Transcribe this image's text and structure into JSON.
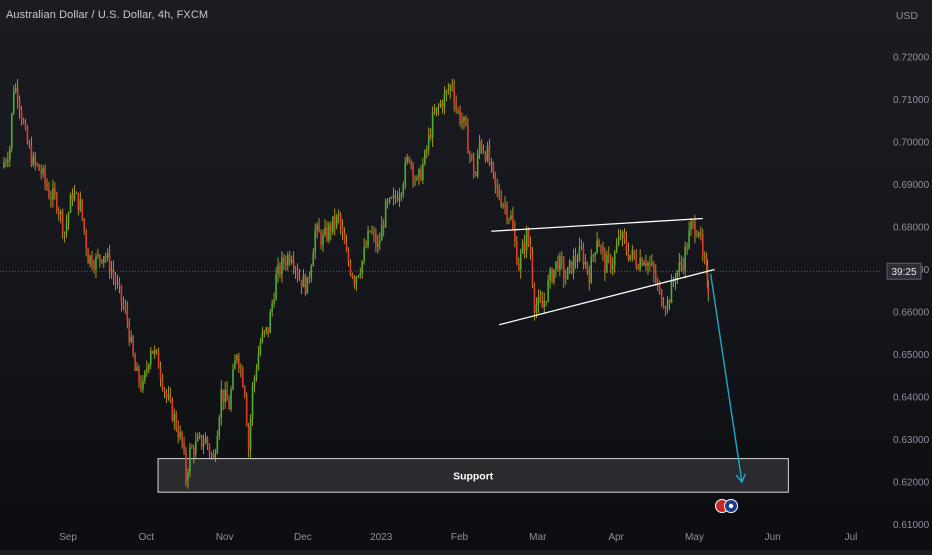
{
  "header": {
    "title": "Australian Dollar / U.S. Dollar, 4h, FXCM",
    "currency": "USD"
  },
  "price_badge": "39:25",
  "colors": {
    "up": "#4caf2f",
    "down": "#e23b2e",
    "wick": "#c8b21e",
    "pattern": "#ffffff",
    "arrow": "#1fa7c9",
    "support_fill": "#2f3034",
    "support_border": "#d8d8d8"
  },
  "chart_data": {
    "type": "line",
    "title": "Australian Dollar / U.S. Dollar, 4h, FXCM",
    "xlabel": "",
    "ylabel": "USD",
    "ylim": [
      0.606,
      0.726
    ],
    "y_ticks": [
      "0.72000",
      "0.71000",
      "0.70000",
      "0.69000",
      "0.68000",
      "0.67000",
      "0.66000",
      "0.65000",
      "0.64000",
      "0.63000",
      "0.62000",
      "0.61000"
    ],
    "x_ticks": [
      "Sep",
      "Oct",
      "Nov",
      "Dec",
      "2023",
      "Feb",
      "Mar",
      "Apr",
      "May",
      "Jun",
      "Jul"
    ],
    "x_positions": [
      1,
      2,
      3,
      4,
      5,
      6,
      7,
      8,
      9,
      10,
      11
    ],
    "series": [
      {
        "values": [
          [
            0.0,
            0.694
          ],
          [
            0.1,
            0.699
          ],
          [
            0.15,
            0.713
          ],
          [
            0.2,
            0.712
          ],
          [
            0.3,
            0.701
          ],
          [
            0.4,
            0.695
          ],
          [
            0.5,
            0.693
          ],
          [
            0.6,
            0.688
          ],
          [
            0.7,
            0.686
          ],
          [
            0.8,
            0.679
          ],
          [
            0.9,
            0.688
          ],
          [
            1.0,
            0.685
          ],
          [
            1.1,
            0.673
          ],
          [
            1.2,
            0.672
          ],
          [
            1.3,
            0.674
          ],
          [
            1.4,
            0.67
          ],
          [
            1.5,
            0.664
          ],
          [
            1.6,
            0.658
          ],
          [
            1.7,
            0.646
          ],
          [
            1.8,
            0.642
          ],
          [
            1.9,
            0.652
          ],
          [
            2.0,
            0.648
          ],
          [
            2.1,
            0.64
          ],
          [
            2.2,
            0.635
          ],
          [
            2.3,
            0.629
          ],
          [
            2.35,
            0.621
          ],
          [
            2.4,
            0.627
          ],
          [
            2.5,
            0.629
          ],
          [
            2.6,
            0.63
          ],
          [
            2.7,
            0.625
          ],
          [
            2.8,
            0.641
          ],
          [
            2.9,
            0.638
          ],
          [
            3.0,
            0.651
          ],
          [
            3.1,
            0.642
          ],
          [
            3.15,
            0.628
          ],
          [
            3.2,
            0.642
          ],
          [
            3.3,
            0.653
          ],
          [
            3.4,
            0.656
          ],
          [
            3.5,
            0.668
          ],
          [
            3.6,
            0.672
          ],
          [
            3.7,
            0.674
          ],
          [
            3.8,
            0.668
          ],
          [
            3.9,
            0.666
          ],
          [
            4.0,
            0.679
          ],
          [
            4.1,
            0.677
          ],
          [
            4.2,
            0.68
          ],
          [
            4.3,
            0.682
          ],
          [
            4.4,
            0.673
          ],
          [
            4.5,
            0.668
          ],
          [
            4.6,
            0.672
          ],
          [
            4.7,
            0.679
          ],
          [
            4.8,
            0.675
          ],
          [
            4.9,
            0.684
          ],
          [
            5.0,
            0.686
          ],
          [
            5.1,
            0.69
          ],
          [
            5.2,
            0.697
          ],
          [
            5.3,
            0.69
          ],
          [
            5.4,
            0.696
          ],
          [
            5.5,
            0.705
          ],
          [
            5.6,
            0.709
          ],
          [
            5.7,
            0.712
          ],
          [
            5.75,
            0.714
          ],
          [
            5.8,
            0.708
          ],
          [
            5.9,
            0.704
          ],
          [
            6.0,
            0.695
          ],
          [
            6.05,
            0.692
          ],
          [
            6.1,
            0.7
          ],
          [
            6.2,
            0.697
          ],
          [
            6.3,
            0.689
          ],
          [
            6.4,
            0.686
          ],
          [
            6.5,
            0.682
          ],
          [
            6.55,
            0.676
          ],
          [
            6.6,
            0.671
          ],
          [
            6.7,
            0.678
          ],
          [
            6.75,
            0.674
          ],
          [
            6.8,
            0.662
          ],
          [
            6.9,
            0.661
          ],
          [
            7.0,
            0.668
          ],
          [
            7.1,
            0.672
          ],
          [
            7.2,
            0.668
          ],
          [
            7.3,
            0.672
          ],
          [
            7.4,
            0.674
          ],
          [
            7.5,
            0.669
          ],
          [
            7.6,
            0.678
          ],
          [
            7.7,
            0.671
          ],
          [
            7.8,
            0.672
          ],
          [
            7.9,
            0.678
          ],
          [
            8.0,
            0.674
          ],
          [
            8.1,
            0.672
          ],
          [
            8.2,
            0.673
          ],
          [
            8.3,
            0.67
          ],
          [
            8.4,
            0.664
          ],
          [
            8.5,
            0.662
          ],
          [
            8.6,
            0.669
          ],
          [
            8.7,
            0.672
          ],
          [
            8.8,
            0.68
          ],
          [
            8.9,
            0.68
          ],
          [
            8.95,
            0.672
          ],
          [
            9.0,
            0.669
          ],
          [
            9.02,
            0.666
          ]
        ]
      }
    ],
    "annotations": {
      "wedge_upper": [
        [
          6.25,
          0.679
        ],
        [
          8.95,
          0.682
        ]
      ],
      "wedge_lower": [
        [
          6.35,
          0.657
        ],
        [
          9.1,
          0.67
        ]
      ],
      "projection": [
        [
          9.05,
          0.669
        ],
        [
          9.45,
          0.62
        ]
      ],
      "support_zone": {
        "x0": 2.15,
        "x1": 10.2,
        "y0": 0.6176,
        "y1": 0.6255,
        "label": "Support"
      }
    },
    "current_price_line": 0.6696,
    "grid": false,
    "legend": "none"
  }
}
